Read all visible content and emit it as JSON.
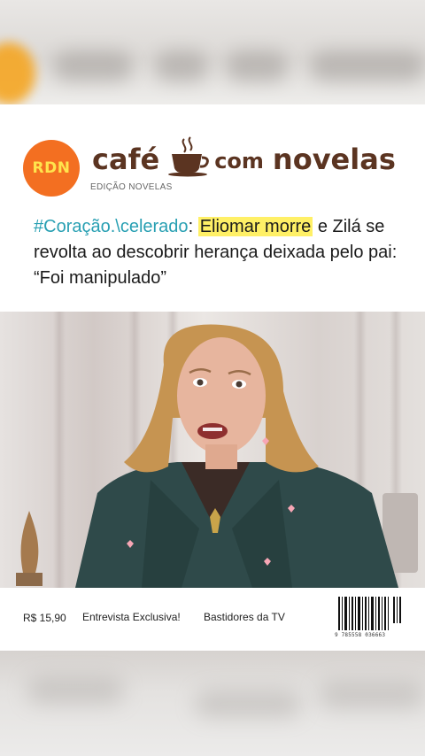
{
  "magazine": {
    "logo_text": "RDN",
    "brand_word1": "café",
    "brand_word2": "com",
    "brand_word3": "novelas",
    "edition": "EDIÇÃO NOVELAS",
    "cup_icon": "coffee-cup-icon"
  },
  "headline": {
    "hashtag": "#Coração.\\celerado",
    "colon": ": ",
    "highlight": "Eliomar morre",
    "rest": " e Zilá se revolta ao descobrir herança deixada pelo pai: “Foi manipulado”"
  },
  "footer": {
    "price": "R$ 15,90",
    "item1": "Entrevista Exclusiva!",
    "item2": "Bastidores da TV",
    "barcode_number": "9 785558 036663"
  },
  "colors": {
    "logo_orange": "#f36f21",
    "logo_text_yellow": "#ffe44d",
    "brand_brown": "#5b3421",
    "hashtag_teal": "#29a0b3",
    "highlight_yellow": "#fff066"
  }
}
